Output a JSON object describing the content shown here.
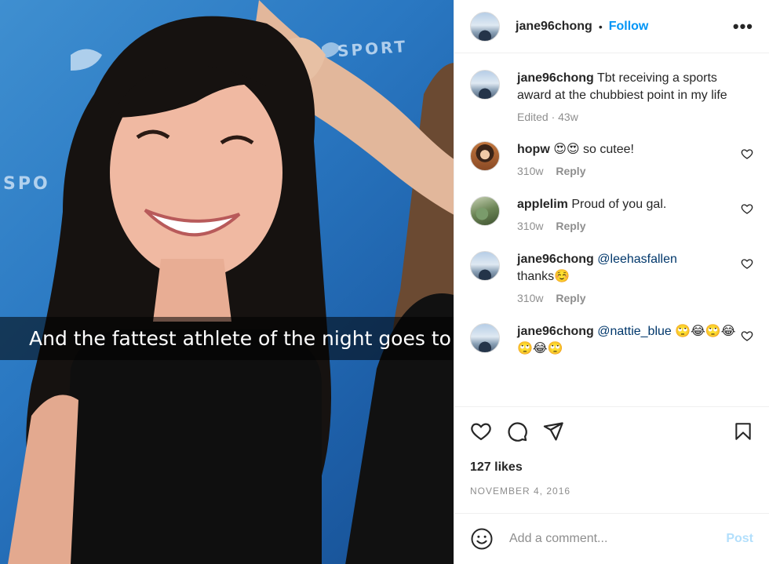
{
  "photo": {
    "caption_overlay": "And the fattest athlete of the night goes to",
    "backdrop_logo": "SPORT",
    "backdrop_logo_short": "SPO"
  },
  "post": {
    "username": "jane96chong",
    "follow_label": "Follow",
    "more_icon": "more-options-icon",
    "caption": {
      "username": "jane96chong",
      "text": "Tbt receiving a sports award at the chubbiest point in my life",
      "meta": "Edited · 43w"
    },
    "comments": [
      {
        "username": "hopw",
        "text": "😍😍 so cutee!",
        "time": "310w",
        "reply_label": "Reply"
      },
      {
        "username": "applelim",
        "text": "Proud of you gal.",
        "time": "310w",
        "reply_label": "Reply"
      },
      {
        "username": "jane96chong",
        "mention": "@leehasfallen",
        "text": "thanks☺️",
        "time": "310w",
        "reply_label": "Reply"
      },
      {
        "username": "jane96chong",
        "mention": "@nattie_blue",
        "text": "🙄😂🙄😂🙄😂🙄",
        "time": "",
        "reply_label": ""
      }
    ],
    "likes": "127 likes",
    "date": "NOVEMBER 4, 2016",
    "comment_placeholder": "Add a comment...",
    "post_label": "Post"
  },
  "colors": {
    "link": "#0095f6",
    "mention": "#00376b",
    "muted": "#8e8e8e",
    "post_disabled": "#b2dffc"
  }
}
